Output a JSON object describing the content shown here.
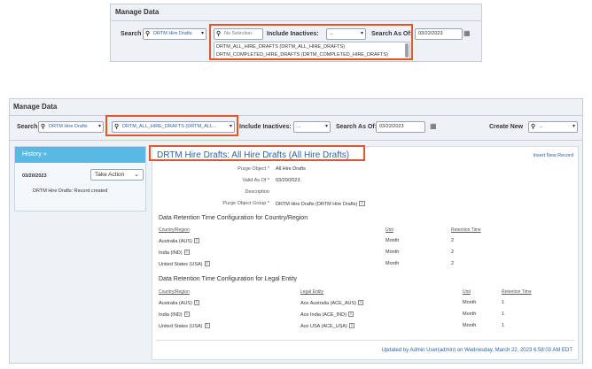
{
  "top_snippet": {
    "title": "Manage Data",
    "search_label": "Search",
    "search_value": "DRTM Hire Drafts",
    "object_select_value": "No Selection",
    "include_inactives_label": "Include Inactives:",
    "include_inactives_value": "...",
    "search_as_of_label": "Search As Of:",
    "search_as_of_value": "03/22/2023",
    "dropdown_options": [
      "DRTM_ALL_HIRE_DRAFTS (DRTM_ALL_HIRE_DRAFTS)",
      "DRTM_COMPLETED_HIRE_DRAFTS (DRTM_COMPLETED_HIRE_DRAFTS)"
    ]
  },
  "main": {
    "title": "Manage Data",
    "search_label": "Search",
    "search_value": "DRTM Hire Drafts",
    "object_select_value": "DRTM_ALL_HIRE_DRAFTS (DRTM_ALL...",
    "include_inactives_label": "Include Inactives:",
    "include_inactives_value": "...",
    "search_as_of_label": "Search As Of:",
    "search_as_of_value": "03/22/2023",
    "create_new_label": "Create New",
    "create_new_value": "..."
  },
  "history": {
    "header": "History «",
    "date": "03/20/2023",
    "take_action": "Take Action",
    "record": "DRTM Hire Drafts: Record created"
  },
  "detail": {
    "title": "DRTM Hire Drafts: All Hire Drafts (All Hire Drafts)",
    "insert_link": "Insert New Record",
    "fields": [
      {
        "label": "Purge Object *",
        "value": "All Hire Drafts"
      },
      {
        "label": "Valid As Of *",
        "value": "03/20/2023"
      },
      {
        "label": "Description",
        "value": ""
      },
      {
        "label": "Purge Object Group *",
        "value": "DRTM Hire Drafts (DRTM Hire Drafts)"
      }
    ],
    "section1": {
      "title": "Data Retention Time Configuration for Country/Region",
      "headers": [
        "Country/Region",
        "Unit",
        "Retention Time"
      ],
      "rows": [
        [
          "Australia (AUS)",
          "Month",
          "2"
        ],
        [
          "India (IND)",
          "Month",
          "2"
        ],
        [
          "United States (USA)",
          "Month",
          "2"
        ]
      ]
    },
    "section2": {
      "title": "Data Retention Time Configuration for Legal Entity",
      "headers": [
        "Country/Region",
        "Legal Entity",
        "Unit",
        "Retention Time"
      ],
      "rows": [
        [
          "Australia (AUS)",
          "Ace Australia (ACE_AUS)",
          "Month",
          "1"
        ],
        [
          "India (IND)",
          "Ace India (ACE_IND)",
          "Month",
          "1"
        ],
        [
          "United States (USA)",
          "Ace USA (ACE_USA)",
          "Month",
          "1"
        ]
      ]
    },
    "footer": "Updated by Admin  User(admin) on Wednesday, March 22, 2023 6:58:03 AM EDT"
  },
  "tag_icon_text": "≡",
  "colors": {
    "highlight": "#e2562a",
    "accent": "#2a64a8",
    "history_header": "#59b9e3"
  }
}
